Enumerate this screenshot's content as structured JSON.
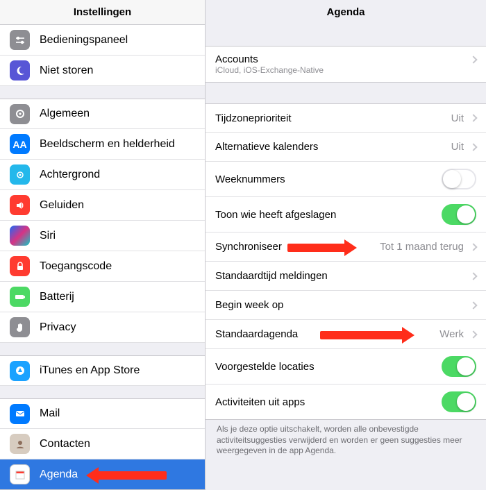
{
  "sidebar": {
    "title": "Instellingen",
    "items": {
      "control_center": "Bedieningspaneel",
      "dnd": "Niet storen",
      "general": "Algemeen",
      "display": "Beeldscherm en helderheid",
      "wallpaper": "Achtergrond",
      "sounds": "Geluiden",
      "siri": "Siri",
      "passcode": "Toegangscode",
      "battery": "Batterij",
      "privacy": "Privacy",
      "appstore": "iTunes en App Store",
      "mail": "Mail",
      "contacts": "Contacten",
      "calendar": "Agenda"
    }
  },
  "detail": {
    "title": "Agenda",
    "accounts_label": "Accounts",
    "accounts_sub": "iCloud, iOS-Exchange-Native",
    "rows": {
      "timezone": {
        "label": "Tijdzoneprioriteit",
        "value": "Uit"
      },
      "altcal": {
        "label": "Alternatieve kalenders",
        "value": "Uit"
      },
      "weeknum": {
        "label": "Weeknummers"
      },
      "found_in": {
        "label": "Toon wie heeft afgeslagen"
      },
      "sync": {
        "label": "Synchroniseer",
        "value": "Tot 1 maand terug"
      },
      "alerts": {
        "label": "Standaardtijd meldingen"
      },
      "weekstart": {
        "label": "Begin week op"
      },
      "defaultcal": {
        "label": "Standaardagenda",
        "value": "Werk"
      },
      "sugloc": {
        "label": "Voorgestelde locaties"
      },
      "appact": {
        "label": "Activiteiten uit apps"
      }
    },
    "footer": "Als je deze optie uitschakelt, worden alle onbevestigde activiteitsuggesties verwijderd en worden er geen suggesties meer weergegeven in de app Agenda."
  }
}
